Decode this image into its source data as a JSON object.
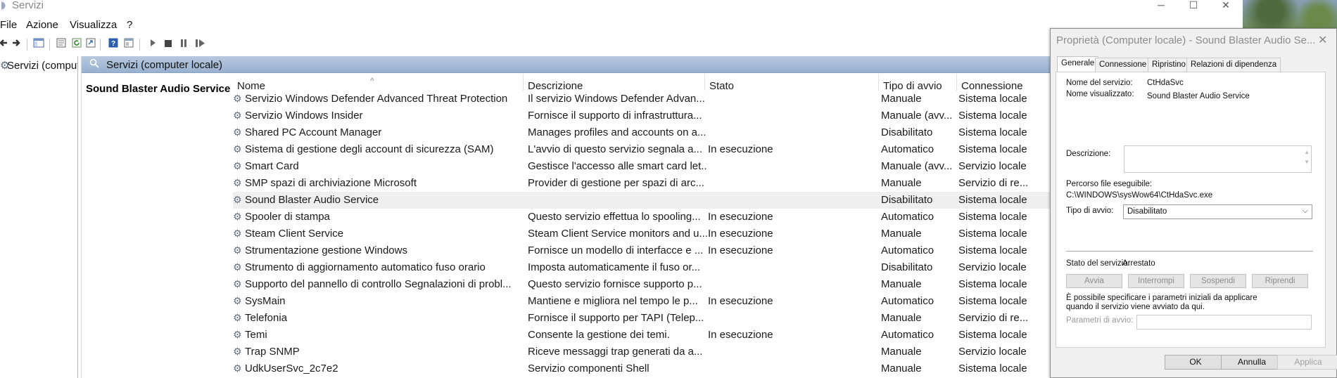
{
  "window": {
    "title": "Servizi",
    "minimize_glyph": "─",
    "maximize_glyph": "☐",
    "close_glyph": "✕"
  },
  "menu": [
    "File",
    "Azione",
    "Visualizza",
    "?"
  ],
  "nav": {
    "item": "Servizi (computer locale)"
  },
  "content": {
    "header": "Servizi (computer locale)",
    "selected_name": "Sound Blaster Audio Service",
    "columns": [
      "Nome",
      "Descrizione",
      "Stato",
      "Tipo di avvio",
      "Connessione"
    ],
    "rows": [
      [
        "Servizio Windows Defender Advanced Threat Protection",
        "Il servizio Windows Defender Advan...",
        "",
        "Manuale",
        "Sistema locale"
      ],
      [
        "Servizio Windows Insider",
        "Fornisce il supporto di infrastruttura...",
        "",
        "Manuale (avv...",
        "Sistema locale"
      ],
      [
        "Shared PC Account Manager",
        "Manages profiles and accounts on a...",
        "",
        "Disabilitato",
        "Sistema locale"
      ],
      [
        "Sistema di gestione degli account di sicurezza (SAM)",
        "L'avvio di questo servizio segnala a...",
        "In esecuzione",
        "Automatico",
        "Sistema locale"
      ],
      [
        "Smart Card",
        "Gestisce l'accesso alle smart card let...",
        "",
        "Manuale (avv...",
        "Servizio locale"
      ],
      [
        "SMP spazi di archiviazione Microsoft",
        "Provider di gestione per spazi di arc...",
        "",
        "Manuale",
        "Servizio di re..."
      ],
      [
        "Sound Blaster Audio Service",
        "",
        "",
        "Disabilitato",
        "Sistema locale"
      ],
      [
        "Spooler di stampa",
        "Questo servizio effettua lo spooling...",
        "In esecuzione",
        "Automatico",
        "Sistema locale"
      ],
      [
        "Steam Client Service",
        "Steam Client Service monitors and u...",
        "In esecuzione",
        "Manuale",
        "Sistema locale"
      ],
      [
        "Strumentazione gestione Windows",
        "Fornisce un modello di interfacce e ...",
        "In esecuzione",
        "Automatico",
        "Sistema locale"
      ],
      [
        "Strumento di aggiornamento automatico fuso orario",
        "Imposta automaticamente il fuso or...",
        "",
        "Disabilitato",
        "Servizio locale"
      ],
      [
        "Supporto del pannello di controllo Segnalazioni di probl...",
        "Questo servizio fornisce supporto p...",
        "",
        "Manuale",
        "Sistema locale"
      ],
      [
        "SysMain",
        "Mantiene e migliora nel tempo le p...",
        "In esecuzione",
        "Automatico",
        "Sistema locale"
      ],
      [
        "Telefonia",
        "Fornisce il supporto per TAPI (Telep...",
        "",
        "Manuale",
        "Servizio di re..."
      ],
      [
        "Temi",
        "Consente la gestione dei temi.",
        "In esecuzione",
        "Automatico",
        "Sistema locale"
      ],
      [
        "Trap SNMP",
        "Riceve messaggi trap generati da a...",
        "",
        "Manuale",
        "Servizio locale"
      ],
      [
        "UdkUserSvc_2c7e2",
        "Servizio componenti Shell",
        "",
        "Manuale",
        "Sistema locale"
      ]
    ]
  },
  "dialog": {
    "title": "Proprietà (Computer locale) - Sound Blaster Audio Se...",
    "close_glyph": "✕",
    "tabs": [
      "Generale",
      "Connessione",
      "Ripristino",
      "Relazioni di dipendenza"
    ],
    "service_name_label": "Nome del servizio:",
    "service_name": "CtHdaSvc",
    "display_name_label": "Nome visualizzato:",
    "display_name": "Sound Blaster Audio Service",
    "description_label": "Descrizione:",
    "exe_path_label": "Percorso file eseguibile:",
    "exe_path": "C:\\WINDOWS\\sysWow64\\CtHdaSvc.exe",
    "startup_type_label": "Tipo di avvio:",
    "startup_type": "Disabilitato",
    "status_label": "Stato del servizio:",
    "status": "Arrestato",
    "buttons": [
      "Avvia",
      "Interrompi",
      "Sospendi",
      "Riprendi"
    ],
    "hint": "È possibile specificare i parametri iniziali da applicare quando il servizio viene avviato da qui.",
    "params_label": "Parametri di avvio:",
    "ok": "OK",
    "cancel": "Annulla",
    "apply": "Applica"
  }
}
